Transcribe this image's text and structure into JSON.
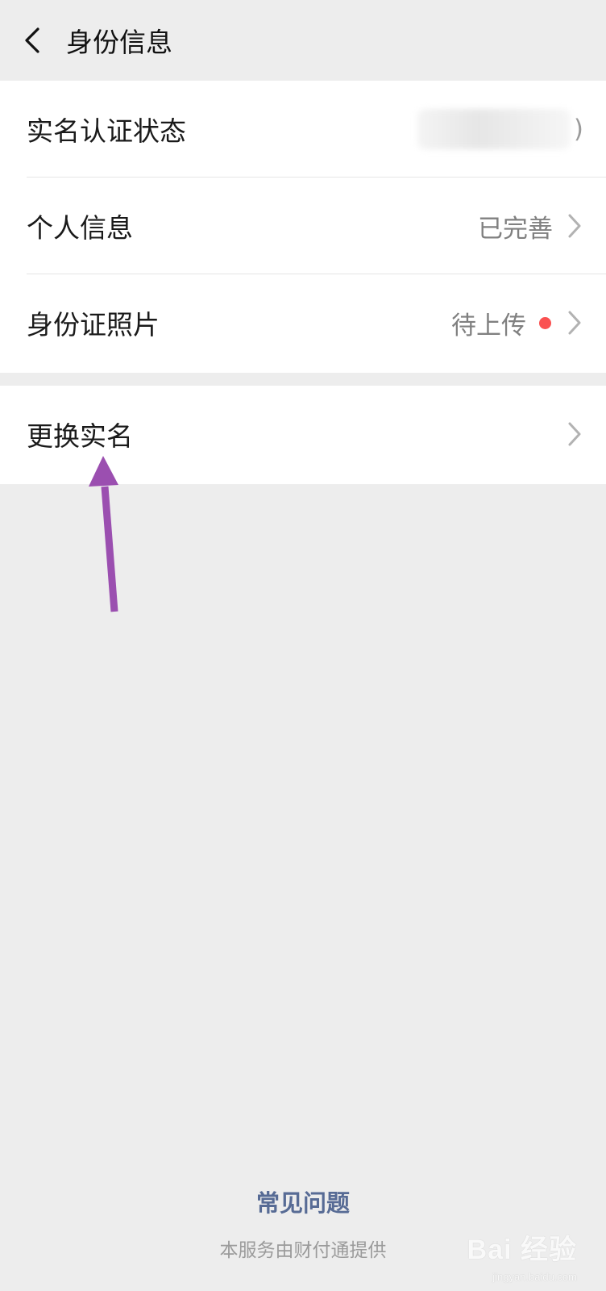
{
  "nav": {
    "title": "身份信息",
    "back_icon": "chevron-left-icon"
  },
  "rows": [
    {
      "label": "实名认证状态",
      "value": "",
      "value_suffix": ")"
    },
    {
      "label": "个人信息",
      "value": "已完善"
    },
    {
      "label": "身份证照片",
      "value": "待上传",
      "dot_color": "#fa5151"
    },
    {
      "label": "更换实名",
      "value": ""
    }
  ],
  "footer": {
    "faq": "常见问题",
    "provider": "本服务由财付通提供"
  },
  "watermark": {
    "brand": "Bai 经验",
    "sub": "jingyan.baidu.com"
  },
  "annotation": {
    "arrow_color": "#9b4fb0"
  }
}
